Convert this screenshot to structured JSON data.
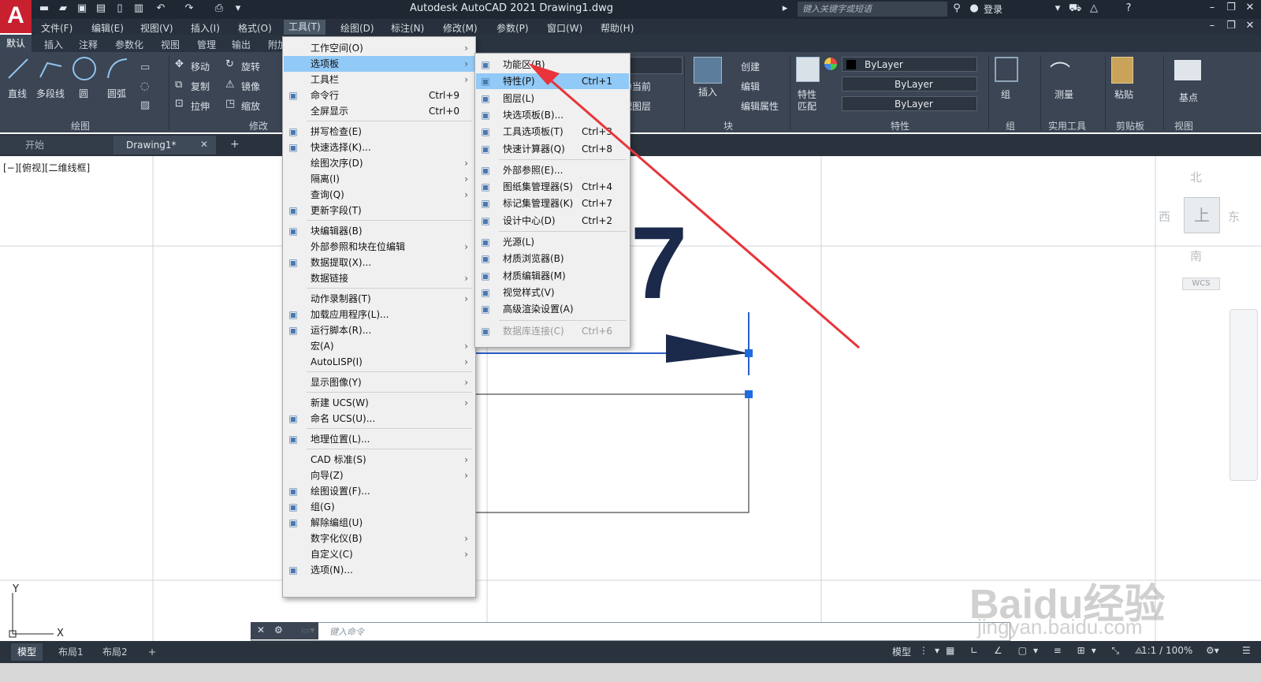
{
  "app": {
    "title": "Autodesk AutoCAD 2021    Drawing1.dwg",
    "logo": "A",
    "search_placeholder": "键入关键字或短语",
    "login": "登录"
  },
  "menubar": [
    "文件(F)",
    "编辑(E)",
    "视图(V)",
    "插入(I)",
    "格式(O)",
    "工具(T)",
    "绘图(D)",
    "标注(N)",
    "修改(M)",
    "参数(P)",
    "窗口(W)",
    "帮助(H)"
  ],
  "ribbon_tabs": [
    "默认",
    "插入",
    "注释",
    "参数化",
    "视图",
    "管理",
    "输出",
    "附加"
  ],
  "ribbon": {
    "draw": {
      "line": "直线",
      "polyline": "多段线",
      "circle": "圆",
      "arc": "圆弧",
      "panel": "绘图"
    },
    "modify": {
      "move": "移动",
      "rotate": "旋转",
      "copy": "复制",
      "mirror": "镜像",
      "stretch": "拉伸",
      "scale": "缩放",
      "panel": "修改"
    },
    "layer_frag": {
      "set_current": "为当前",
      "match_layer": "配图层"
    },
    "block": {
      "insert": "插入",
      "create": "创建",
      "edit": "编辑",
      "edit_attr": "编辑属性",
      "panel": "块"
    },
    "properties": {
      "match": "特性",
      "match2": "匹配",
      "bylayer1": "ByLayer",
      "bylayer2": "ByLayer",
      "bylayer3": "ByLayer",
      "panel": "特性"
    },
    "groups": {
      "group": "组",
      "panel": "组"
    },
    "utilities": {
      "measure": "测量",
      "panel": "实用工具"
    },
    "clipboard": {
      "paste": "粘贴",
      "panel": "剪贴板"
    },
    "view": {
      "base": "基点",
      "panel": "视图"
    }
  },
  "doc_tabs": {
    "start": "开始",
    "drawing": "Drawing1*",
    "close": "✕",
    "add": "+"
  },
  "viewport_label": "[−][俯视][二维线框]",
  "viewcube": {
    "north": "北",
    "south": "南",
    "east": "东",
    "west": "西",
    "top": "上",
    "wcs": "WCS"
  },
  "tools_menu": [
    {
      "label": "工作空间(O)",
      "arrow": true
    },
    {
      "label": "选项板",
      "arrow": true,
      "highlight": true
    },
    {
      "label": "工具栏",
      "arrow": true
    },
    {
      "label": "命令行",
      "shortcut": "Ctrl+9",
      "icon": "cmd"
    },
    {
      "label": "全屏显示",
      "shortcut": "Ctrl+0"
    },
    {
      "sep": true
    },
    {
      "label": "拼写检查(E)",
      "icon": "abc"
    },
    {
      "label": "快速选择(K)...",
      "icon": "qs"
    },
    {
      "label": "绘图次序(D)",
      "arrow": true
    },
    {
      "label": "隔离(I)",
      "arrow": true
    },
    {
      "label": "查询(Q)",
      "arrow": true
    },
    {
      "label": "更新字段(T)",
      "icon": "upd"
    },
    {
      "sep": true
    },
    {
      "label": "块编辑器(B)",
      "icon": "blk"
    },
    {
      "label": "外部参照和块在位编辑",
      "arrow": true
    },
    {
      "label": "数据提取(X)...",
      "icon": "dx"
    },
    {
      "label": "数据链接",
      "arrow": true
    },
    {
      "sep": true
    },
    {
      "label": "动作录制器(T)",
      "arrow": true
    },
    {
      "label": "加载应用程序(L)...",
      "icon": "app"
    },
    {
      "label": "运行脚本(R)...",
      "icon": "scr"
    },
    {
      "label": "宏(A)",
      "arrow": true
    },
    {
      "label": "AutoLISP(I)",
      "arrow": true
    },
    {
      "sep": true
    },
    {
      "label": "显示图像(Y)",
      "arrow": true
    },
    {
      "sep": true
    },
    {
      "label": "新建 UCS(W)",
      "arrow": true
    },
    {
      "label": "命名 UCS(U)...",
      "icon": "ucs"
    },
    {
      "sep": true
    },
    {
      "label": "地理位置(L)...",
      "icon": "geo"
    },
    {
      "sep": true
    },
    {
      "label": "CAD 标准(S)",
      "arrow": true
    },
    {
      "label": "向导(Z)",
      "arrow": true
    },
    {
      "label": "绘图设置(F)...",
      "icon": "ds"
    },
    {
      "label": "组(G)",
      "icon": "grp"
    },
    {
      "label": "解除编组(U)",
      "icon": "ugrp"
    },
    {
      "label": "数字化仪(B)",
      "arrow": true
    },
    {
      "label": "自定义(C)",
      "arrow": true
    },
    {
      "label": "选项(N)...",
      "icon": "chk"
    }
  ],
  "palettes_menu": [
    {
      "label": "功能区(B)",
      "icon": "rib"
    },
    {
      "label": "特性(P)",
      "shortcut": "Ctrl+1",
      "highlight": true,
      "icon": "prop"
    },
    {
      "label": "图层(L)",
      "icon": "lay"
    },
    {
      "label": "块选项板(B)...",
      "icon": "bp"
    },
    {
      "label": "工具选项板(T)",
      "shortcut": "Ctrl+3",
      "icon": "tp"
    },
    {
      "label": "快速计算器(Q)",
      "shortcut": "Ctrl+8",
      "icon": "calc"
    },
    {
      "sep": true
    },
    {
      "label": "外部参照(E)...",
      "icon": "xr"
    },
    {
      "label": "图纸集管理器(S)",
      "shortcut": "Ctrl+4",
      "icon": "ss"
    },
    {
      "label": "标记集管理器(K)",
      "shortcut": "Ctrl+7",
      "icon": "mk"
    },
    {
      "label": "设计中心(D)",
      "shortcut": "Ctrl+2",
      "icon": "dc"
    },
    {
      "sep": true
    },
    {
      "label": "光源(L)",
      "icon": "lt"
    },
    {
      "label": "材质浏览器(B)",
      "icon": "mb"
    },
    {
      "label": "材质编辑器(M)",
      "icon": "me"
    },
    {
      "label": "视觉样式(V)",
      "icon": "vs"
    },
    {
      "label": "高级渲染设置(A)",
      "icon": "rs"
    },
    {
      "sep": true
    },
    {
      "label": "数据库连接(C)",
      "shortcut": "Ctrl+6",
      "disabled": true,
      "icon": "db"
    }
  ],
  "command_line": {
    "placeholder": "键入命令"
  },
  "status": {
    "layout_tabs": [
      "模型",
      "布局1",
      "布局2"
    ],
    "add": "+",
    "model_label": "模型",
    "scale": "1:1 / 100%"
  },
  "ucs": {
    "x": "X",
    "y": "Y"
  },
  "canvas_text": {
    "digit": "7"
  },
  "watermark": {
    "brand": "Baidu经验",
    "url": "jingyan.baidu.com"
  },
  "colors": {
    "highlight": "#91c9f7",
    "annotation_arrow": "#e8343a",
    "dark_ui": "#3b4553",
    "drawing_navy": "#1b2a4a"
  }
}
